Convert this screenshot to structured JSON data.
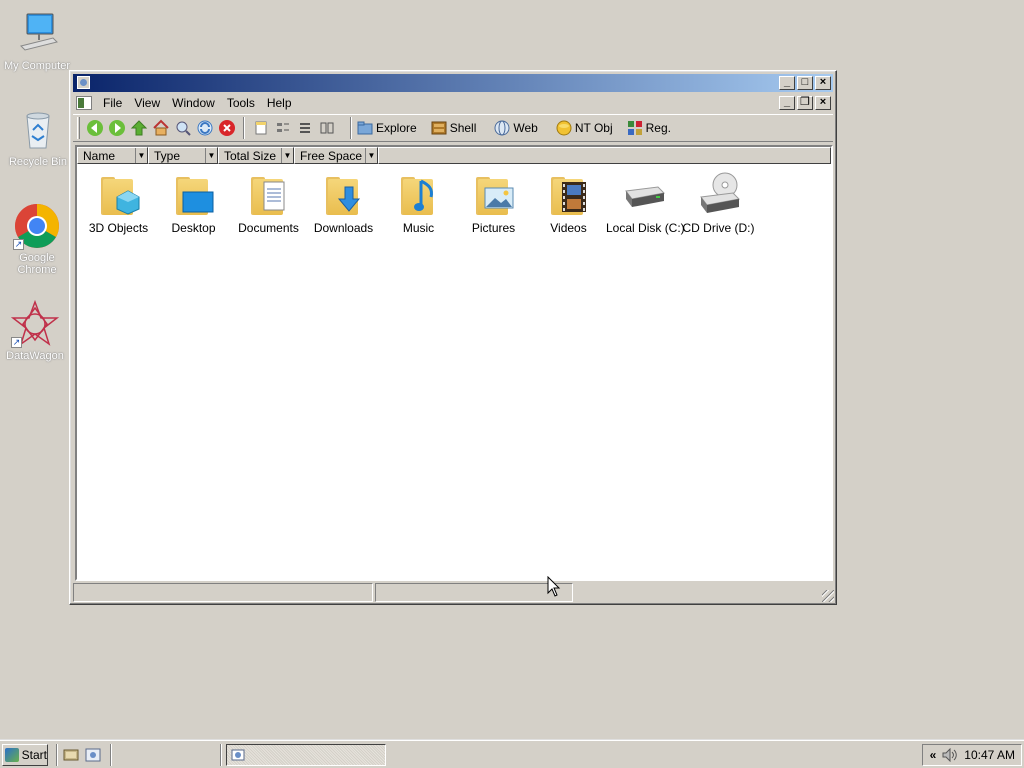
{
  "desktop": {
    "icons": [
      {
        "label": "My Computer"
      },
      {
        "label": "Recycle Bin"
      },
      {
        "label": "Google Chrome"
      },
      {
        "label": "DataWagon"
      }
    ]
  },
  "window": {
    "title": "",
    "menu": [
      "File",
      "View",
      "Window",
      "Tools",
      "Help"
    ],
    "toolbar": {
      "nav_icons": [
        "back-arrow-icon",
        "forward-arrow-icon",
        "up-arrow-icon",
        "home-icon",
        "search-icon",
        "refresh-icon",
        "stop-icon"
      ],
      "view_icons": [
        "new-file-icon",
        "large-icons-view-icon",
        "list-view-icon",
        "details-view-icon"
      ],
      "labels": {
        "explore": "Explore",
        "shell": "Shell",
        "web": "Web",
        "ntobj": "NT Obj",
        "reg": "Reg."
      }
    },
    "columns": [
      "Name",
      "Type",
      "Total Size",
      "Free Space"
    ],
    "items": [
      {
        "label": "3D Objects",
        "icon": "3d-objects-folder-icon"
      },
      {
        "label": "Desktop",
        "icon": "desktop-folder-icon"
      },
      {
        "label": "Documents",
        "icon": "documents-folder-icon"
      },
      {
        "label": "Downloads",
        "icon": "downloads-folder-icon"
      },
      {
        "label": "Music",
        "icon": "music-folder-icon"
      },
      {
        "label": "Pictures",
        "icon": "pictures-folder-icon"
      },
      {
        "label": "Videos",
        "icon": "videos-folder-icon"
      },
      {
        "label": "Local Disk (C:)",
        "icon": "hard-disk-icon"
      },
      {
        "label": "CD Drive (D:)",
        "icon": "cd-drive-icon"
      }
    ],
    "status": [
      "",
      ""
    ]
  },
  "taskbar": {
    "start_label": "Start",
    "clock": "10:47 AM",
    "tray_icons": [
      "chevron-left-icon",
      "speaker-icon"
    ]
  },
  "colors": {
    "face": "#d4d0c8",
    "title_active_start": "#0a246a",
    "title_active_end": "#a6caf0",
    "folder": "#e9bd4e"
  }
}
